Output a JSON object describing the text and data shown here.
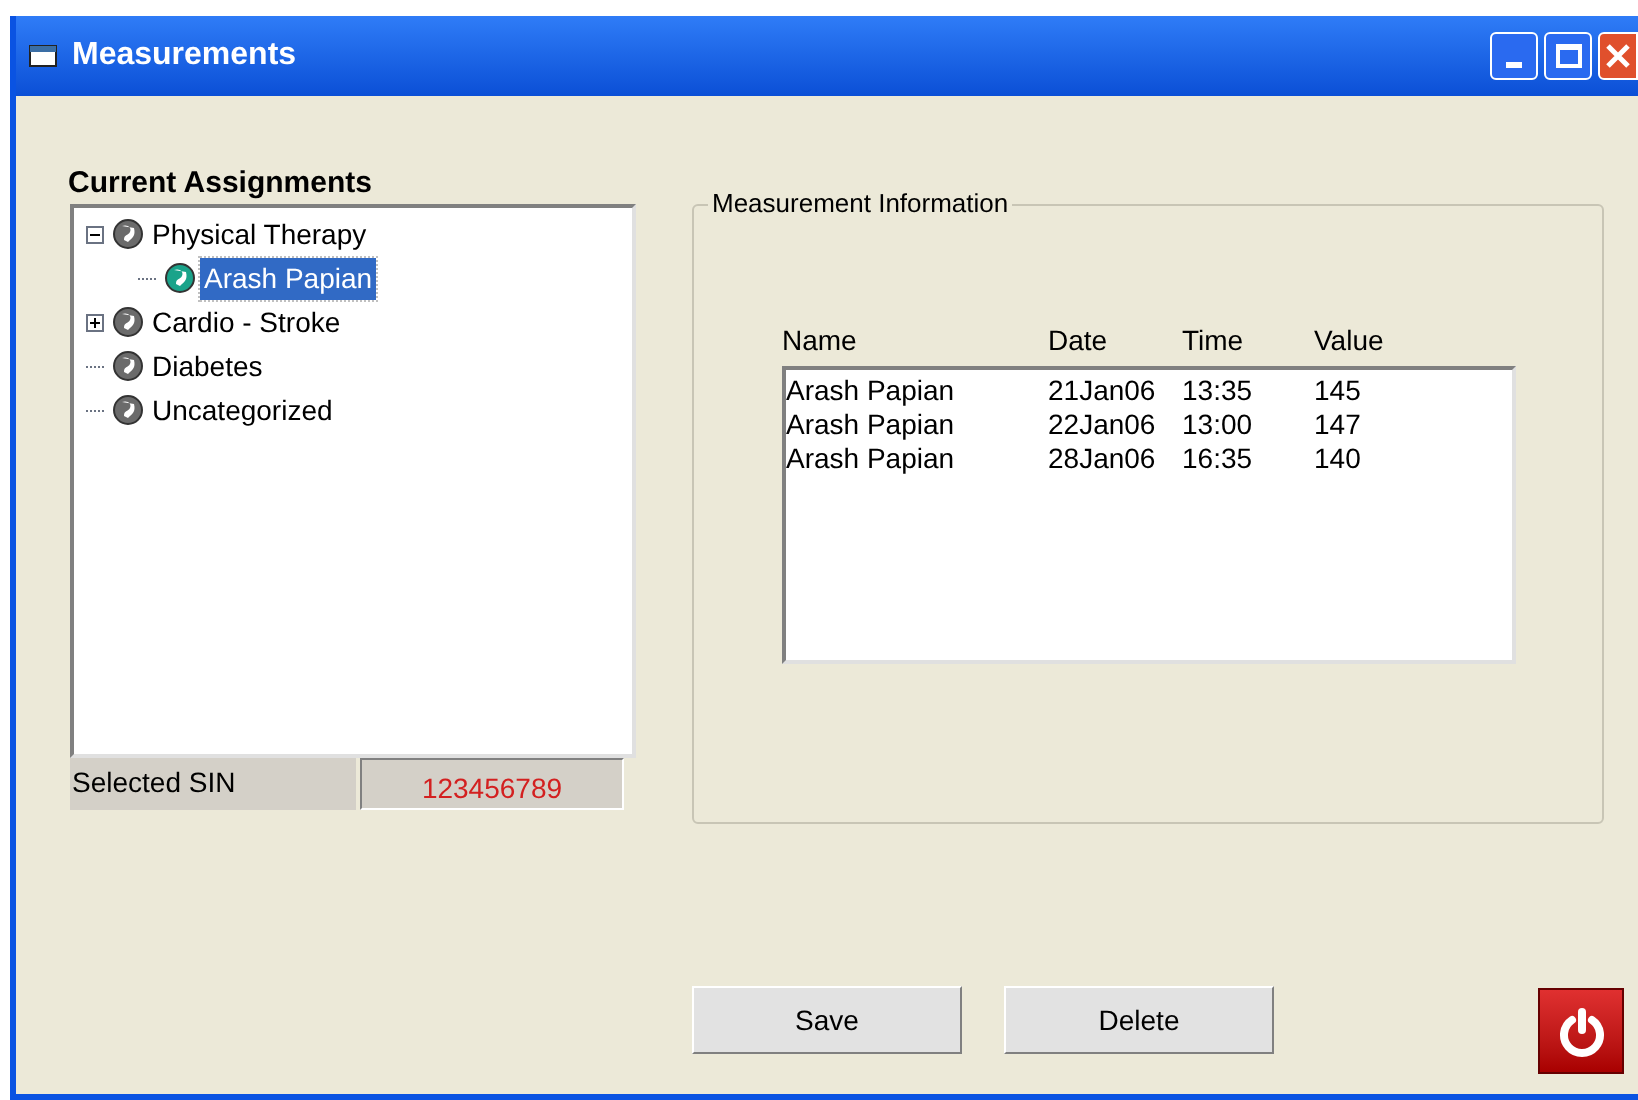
{
  "window": {
    "title": "Measurements"
  },
  "assignments": {
    "title": "Current Assignments",
    "tree": [
      {
        "label": "Physical Therapy",
        "expanded": true,
        "selected": false,
        "children": [
          {
            "label": "Arash Papian",
            "selected": true
          }
        ]
      },
      {
        "label": "Cardio - Stroke",
        "expanded": false,
        "selected": false
      },
      {
        "label": "Diabetes",
        "selected": false
      },
      {
        "label": "Uncategorized",
        "selected": false
      }
    ]
  },
  "selected_sin": {
    "label": "Selected SIN",
    "value": "123456789"
  },
  "measurement_info": {
    "title": "Measurement Information",
    "columns": [
      "Name",
      "Date",
      "Time",
      "Value"
    ],
    "rows": [
      [
        "Arash Papian",
        "21Jan06",
        "13:35",
        "145"
      ],
      [
        "Arash Papian",
        "22Jan06",
        "13:00",
        "147"
      ],
      [
        "Arash Papian",
        "28Jan06",
        "16:35",
        "140"
      ]
    ]
  },
  "buttons": [
    "Save",
    "Delete"
  ]
}
